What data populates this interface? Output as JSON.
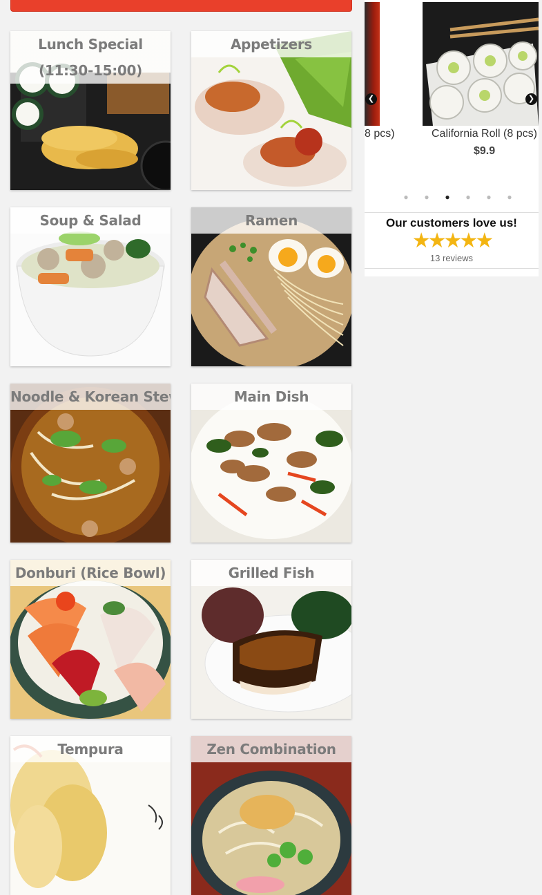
{
  "categories": [
    {
      "label": "Lunch Special (11:30-15:00)"
    },
    {
      "label": "Appetizers"
    },
    {
      "label": "Soup & Salad"
    },
    {
      "label": "Ramen"
    },
    {
      "label": "Noodle & Korean Stew"
    },
    {
      "label": "Main Dish"
    },
    {
      "label": "Donburi (Rice Bowl)"
    },
    {
      "label": "Grilled Fish"
    },
    {
      "label": "Tempura"
    },
    {
      "label": "Zen Combination"
    }
  ],
  "carousel": {
    "prev_item_name": "8 pcs)",
    "current_item_name": "California Roll (8 pcs)",
    "current_item_price": "$9.9",
    "prev_arrow": "❮",
    "next_arrow": "❯",
    "dot_char": "●",
    "dot_count": 6,
    "active_dot": 3
  },
  "reviews": {
    "headline": "Our customers love us!",
    "stars": "★★★★★",
    "rating": 5,
    "count_text": "13 reviews"
  },
  "colors": {
    "accent": "#e9402b",
    "star": "#f3b512"
  }
}
